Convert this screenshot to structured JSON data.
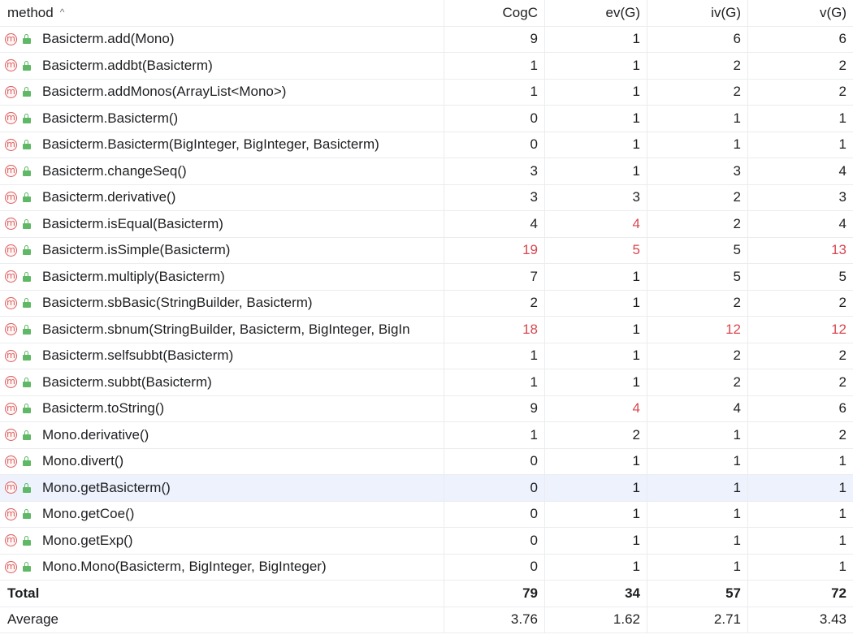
{
  "columns": {
    "method": "method",
    "cogc": "CogC",
    "ev": "ev(G)",
    "iv": "iv(G)",
    "v": "v(G)",
    "sort_indicator": "^"
  },
  "icons": {
    "method": "m-method-icon",
    "access": "lock-open-icon"
  },
  "colors": {
    "warning": "#d9474f",
    "selected_row": "#edf2fc",
    "method_icon": "#db5c5c",
    "lock_icon": "#5fb865"
  },
  "rows": [
    {
      "method": "Basicterm.add(Mono)",
      "cogc": "9",
      "ev": "1",
      "iv": "6",
      "v": "6",
      "flags": {}
    },
    {
      "method": "Basicterm.addbt(Basicterm)",
      "cogc": "1",
      "ev": "1",
      "iv": "2",
      "v": "2",
      "flags": {}
    },
    {
      "method": "Basicterm.addMonos(ArrayList<Mono>)",
      "cogc": "1",
      "ev": "1",
      "iv": "2",
      "v": "2",
      "flags": {}
    },
    {
      "method": "Basicterm.Basicterm()",
      "cogc": "0",
      "ev": "1",
      "iv": "1",
      "v": "1",
      "flags": {}
    },
    {
      "method": "Basicterm.Basicterm(BigInteger, BigInteger, Basicterm)",
      "cogc": "0",
      "ev": "1",
      "iv": "1",
      "v": "1",
      "flags": {}
    },
    {
      "method": "Basicterm.changeSeq()",
      "cogc": "3",
      "ev": "1",
      "iv": "3",
      "v": "4",
      "flags": {}
    },
    {
      "method": "Basicterm.derivative()",
      "cogc": "3",
      "ev": "3",
      "iv": "2",
      "v": "3",
      "flags": {}
    },
    {
      "method": "Basicterm.isEqual(Basicterm)",
      "cogc": "4",
      "ev": "4",
      "iv": "2",
      "v": "4",
      "flags": {
        "ev": true
      }
    },
    {
      "method": "Basicterm.isSimple(Basicterm)",
      "cogc": "19",
      "ev": "5",
      "iv": "5",
      "v": "13",
      "flags": {
        "cogc": true,
        "ev": true,
        "v": true
      }
    },
    {
      "method": "Basicterm.multiply(Basicterm)",
      "cogc": "7",
      "ev": "1",
      "iv": "5",
      "v": "5",
      "flags": {}
    },
    {
      "method": "Basicterm.sbBasic(StringBuilder, Basicterm)",
      "cogc": "2",
      "ev": "1",
      "iv": "2",
      "v": "2",
      "flags": {}
    },
    {
      "method": "Basicterm.sbnum(StringBuilder, Basicterm, BigInteger, BigIn",
      "cogc": "18",
      "ev": "1",
      "iv": "12",
      "v": "12",
      "flags": {
        "cogc": true,
        "iv": true,
        "v": true
      }
    },
    {
      "method": "Basicterm.selfsubbt(Basicterm)",
      "cogc": "1",
      "ev": "1",
      "iv": "2",
      "v": "2",
      "flags": {}
    },
    {
      "method": "Basicterm.subbt(Basicterm)",
      "cogc": "1",
      "ev": "1",
      "iv": "2",
      "v": "2",
      "flags": {}
    },
    {
      "method": "Basicterm.toString()",
      "cogc": "9",
      "ev": "4",
      "iv": "4",
      "v": "6",
      "flags": {
        "ev": true
      }
    },
    {
      "method": "Mono.derivative()",
      "cogc": "1",
      "ev": "2",
      "iv": "1",
      "v": "2",
      "flags": {}
    },
    {
      "method": "Mono.divert()",
      "cogc": "0",
      "ev": "1",
      "iv": "1",
      "v": "1",
      "flags": {}
    },
    {
      "method": "Mono.getBasicterm()",
      "cogc": "0",
      "ev": "1",
      "iv": "1",
      "v": "1",
      "flags": {},
      "selected": true
    },
    {
      "method": "Mono.getCoe()",
      "cogc": "0",
      "ev": "1",
      "iv": "1",
      "v": "1",
      "flags": {}
    },
    {
      "method": "Mono.getExp()",
      "cogc": "0",
      "ev": "1",
      "iv": "1",
      "v": "1",
      "flags": {}
    },
    {
      "method": "Mono.Mono(Basicterm, BigInteger, BigInteger)",
      "cogc": "0",
      "ev": "1",
      "iv": "1",
      "v": "1",
      "flags": {}
    }
  ],
  "total": {
    "label": "Total",
    "cogc": "79",
    "ev": "34",
    "iv": "57",
    "v": "72"
  },
  "average": {
    "label": "Average",
    "cogc": "3.76",
    "ev": "1.62",
    "iv": "2.71",
    "v": "3.43"
  }
}
